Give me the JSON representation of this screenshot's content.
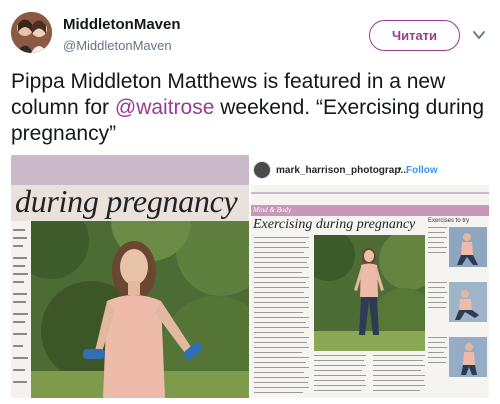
{
  "tweet": {
    "display_name": "MiddletonMaven",
    "handle": "@MiddletonMaven",
    "follow_label": "Читати",
    "text_before": "Pippa Middleton Matthews is featured in a new column for ",
    "mention": "@waitrose",
    "text_after": " weekend. “Exercising during pregnancy”",
    "icons": [
      "avatar",
      "chevron-down-icon"
    ],
    "accent_color": "#9b3b8f"
  },
  "media": {
    "left_heading": "during pregnancy",
    "instagram": {
      "username": "mark_harrison_photograp...",
      "separator": "•",
      "follow_label": "Follow"
    },
    "spread_section": "Mind & Body",
    "spread_heading": "Exercising during pregnancy",
    "spread_sidebar": "Exercises to try"
  }
}
